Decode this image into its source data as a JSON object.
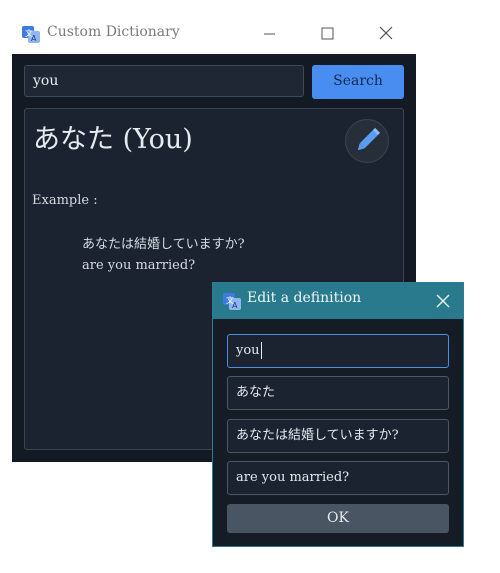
{
  "window": {
    "title": "Custom Dictionary",
    "icons": {
      "app": "translate-icon",
      "minimize": "minimize-icon",
      "maximize": "maximize-icon",
      "close": "close-icon"
    }
  },
  "search": {
    "value": "you",
    "button_label": "Search"
  },
  "result": {
    "title": "あなた (You)",
    "example_label": "Example :",
    "example_japanese": "あなたは結婚していますか?",
    "example_english": "are you married?",
    "edit_icon": "pencil-icon"
  },
  "dialog": {
    "title": "Edit a definition",
    "fields": {
      "word": "you",
      "translation": "あなた",
      "example_japanese": "あなたは結婚していますか?",
      "example_english": "are you married?"
    },
    "ok_label": "OK"
  },
  "colors": {
    "accent": "#4a8df0",
    "dialog_titlebar": "#2a7a8e",
    "dark_bg": "#141a23"
  }
}
